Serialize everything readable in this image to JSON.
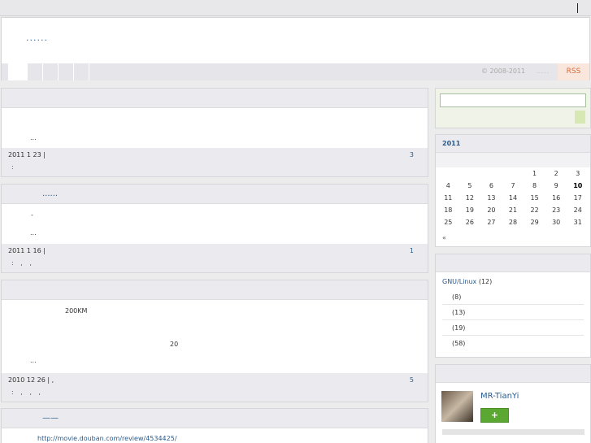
{
  "header": {
    "site_title": "......",
    "copyright": "© 2008-2011",
    "nav_dots": "......",
    "rss_label": "RSS"
  },
  "posts": [
    {
      "title": "",
      "lines": [
        "..."
      ],
      "date": "2011 1 23  |",
      "comments": "3",
      "tags": ":"
    },
    {
      "title": "......",
      "lines": [
        "-",
        "..."
      ],
      "date": "2011 1 16  |",
      "comments": "1",
      "tags": ": , ,"
    },
    {
      "title": "",
      "lines": [
        "200KM",
        "20",
        "..."
      ],
      "date": "2010 12 26  |      ,",
      "comments": "5",
      "tags": ": , , ,"
    },
    {
      "title": "——",
      "link": "http://movie.douban.com/review/4534425/"
    }
  ],
  "calendar": {
    "title": "2011",
    "weeks": [
      [
        "",
        "",
        "",
        "",
        "1",
        "2",
        "3"
      ],
      [
        "4",
        "5",
        "6",
        "7",
        "8",
        "9",
        "10"
      ],
      [
        "11",
        "12",
        "13",
        "14",
        "15",
        "16",
        "17"
      ],
      [
        "18",
        "19",
        "20",
        "21",
        "22",
        "23",
        "24"
      ],
      [
        "25",
        "26",
        "27",
        "28",
        "29",
        "30",
        "31"
      ]
    ],
    "today": "10",
    "prev": "«"
  },
  "categories": [
    {
      "label": "GNU/Linux",
      "count": "(12)"
    },
    {
      "label": "",
      "count": "(8)"
    },
    {
      "label": "",
      "count": "(13)"
    },
    {
      "label": "",
      "count": "(19)"
    },
    {
      "label": "",
      "count": "(58)"
    }
  ],
  "profile": {
    "username": "MR-TianYi",
    "follow_label": "+"
  }
}
